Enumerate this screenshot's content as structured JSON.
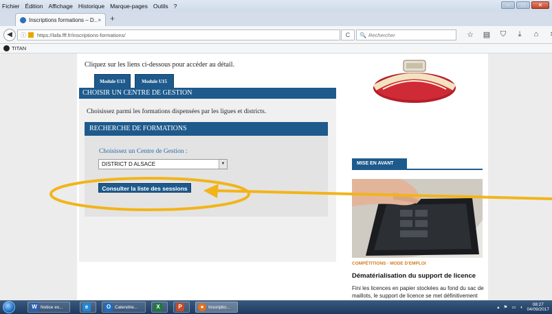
{
  "menubar": {
    "items": [
      "Fichier",
      "Édition",
      "Affichage",
      "Historique",
      "Marque-pages",
      "Outils",
      "?"
    ]
  },
  "browser": {
    "tab_title": "Inscriptions formations – D...",
    "tab_close": "×",
    "new_tab": "+",
    "url": "https://lafa.fff.fr/inscriptions-formations/",
    "search_placeholder": "Rechercher",
    "bookmark_label": "TITAN"
  },
  "page": {
    "intro_text": "Cliquez sur les liens ci-dessous pour accéder au détail.",
    "module_tabs": [
      "Module U13",
      "Module U15"
    ],
    "section_header": "CHOISIR UN CENTRE DE GESTION",
    "choose_text": "Choisissez parmi les formations dispensées par les ligues et districts.",
    "search_header": "RECHERCHE DE FORMATIONS",
    "centre_label": "Choisissez un Centre de Gestion :",
    "centre_selected": "DISTRICT D ALSACE",
    "consult_button": "Consulter la liste des sessions"
  },
  "sidebar": {
    "mise_en_avant": "MISE EN AVANT",
    "category": "COMPÉTITIONS · MODE D'EMPLOI",
    "article_title": "Dématérialisation du support de licence",
    "article_body": "Fini les licences en papier stockées au fond du sac de maillots, le support de licence se met définitivement au digital. Initiée par la mise en place de la Feuille de"
  },
  "taskbar": {
    "items": [
      {
        "icon": "W",
        "label": "Notice ex...",
        "color": "#2b5fb4"
      },
      {
        "icon": "e",
        "label": "",
        "color": "#1e88d9"
      },
      {
        "icon": "O",
        "label": "Calendrie...",
        "color": "#1b6ec2"
      },
      {
        "icon": "X",
        "label": "",
        "color": "#1f7a3a"
      },
      {
        "icon": "P",
        "label": "",
        "color": "#c84a25"
      },
      {
        "icon": "●",
        "label": "Inscriptio...",
        "color": "#e07020"
      }
    ],
    "clock_time": "08:27",
    "clock_date": "04/09/2017"
  },
  "colors": {
    "accent_blue": "#1e5a8c",
    "annotation": "#f2b418",
    "link_blue": "#2a6aa6"
  }
}
